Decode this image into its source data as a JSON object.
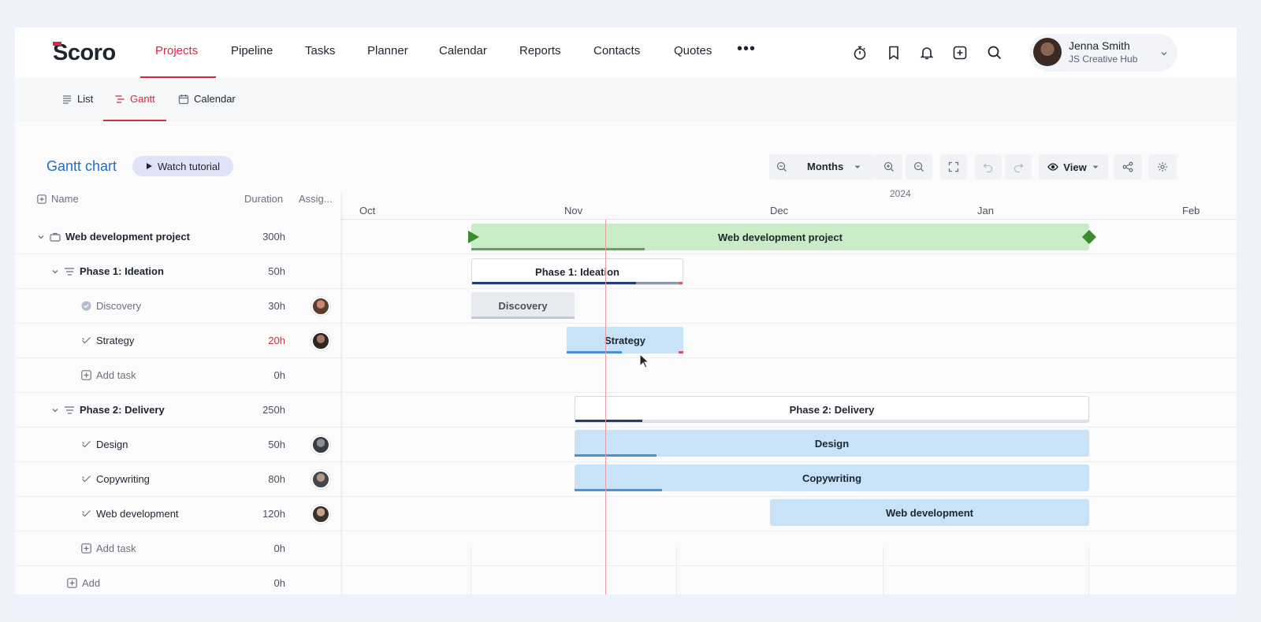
{
  "brand": {
    "logo": "Scoro",
    "accent": "#d42d3f"
  },
  "nav": {
    "items": [
      "Projects",
      "Pipeline",
      "Tasks",
      "Planner",
      "Calendar",
      "Reports",
      "Contacts",
      "Quotes"
    ],
    "active": "Projects",
    "more_icon": "more-dots-icon",
    "icons": [
      "stopwatch-icon",
      "bookmark-icon",
      "bell-icon",
      "plus-square-icon",
      "search-icon"
    ]
  },
  "user": {
    "name": "Jenna Smith",
    "org": "JS Creative Hub"
  },
  "subtabs": {
    "list": "List",
    "gantt": "Gantt",
    "calendar": "Calendar",
    "active": "Gantt"
  },
  "gantt": {
    "title": "Gantt chart",
    "tutorial": "Watch tutorial",
    "zoom_value": "Months",
    "view_label": "View",
    "columns": {
      "name": "Name",
      "duration": "Duration",
      "assignee": "Assig..."
    },
    "year": "2024",
    "months": [
      "Oct",
      "Nov",
      "Dec",
      "Jan",
      "Feb"
    ],
    "rows": [
      {
        "name": "Web development project",
        "duration": "300h",
        "type": "project",
        "assignee": false
      },
      {
        "name": "Phase 1: Ideation",
        "duration": "50h",
        "type": "phase",
        "assignee": false
      },
      {
        "name": "Discovery",
        "duration": "30h",
        "type": "task-done",
        "assignee": true
      },
      {
        "name": "Strategy",
        "duration": "20h",
        "type": "task",
        "duration_over": true,
        "assignee": true
      },
      {
        "name": "Add task",
        "duration": "0h",
        "type": "add",
        "assignee": false
      },
      {
        "name": "Phase 2: Delivery",
        "duration": "250h",
        "type": "phase",
        "assignee": false
      },
      {
        "name": "Design",
        "duration": "50h",
        "type": "task",
        "assignee": true
      },
      {
        "name": "Copywriting",
        "duration": "80h",
        "type": "task",
        "assignee": true
      },
      {
        "name": "Web development",
        "duration": "120h",
        "type": "task",
        "assignee": true
      },
      {
        "name": "Add task",
        "duration": "0h",
        "type": "add",
        "assignee": false
      },
      {
        "name": "Add",
        "duration": "0h",
        "type": "add-phase",
        "assignee": false
      }
    ],
    "bars": {
      "project": {
        "label": "Web development project",
        "progress": 0.28
      },
      "phase1": {
        "label": "Phase 1: Ideation",
        "progress": 0.78
      },
      "discovery": {
        "label": "Discovery",
        "progress": 1.0
      },
      "strategy": {
        "label": "Strategy",
        "progress": 0.47
      },
      "phase2": {
        "label": "Phase 2: Delivery",
        "progress": 0.13
      },
      "design": {
        "label": "Design",
        "progress": 0.16
      },
      "copywriting": {
        "label": "Copywriting",
        "progress": 0.17
      },
      "webdev": {
        "label": "Web development",
        "progress": 0.0
      }
    }
  },
  "colors": {
    "project_bar": "#c9ebc6",
    "project_marker": "#3a8a2e",
    "task_bar": "#c8e2f7",
    "progress_blue": "#4a90d9",
    "phase_progress": "#1d3f75",
    "today_line": "#e79aa3",
    "link_blue": "#1f6fc0"
  }
}
